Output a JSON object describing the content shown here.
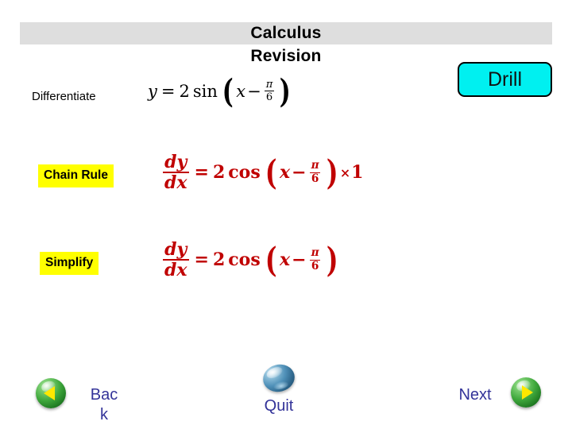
{
  "slide": {
    "title_line1": "Calculus",
    "title_line2": "Revision",
    "banner_color": "#dedede"
  },
  "drill_button": {
    "label": "Drill",
    "fill_color": "#00f0f0",
    "border_color": "#000000"
  },
  "steps": [
    {
      "label": "Differentiate",
      "highlighted": false,
      "equation_text": "y = 2 sin ( x - π/6 )",
      "color": "#000000",
      "parts": {
        "lhs": "y",
        "eq": "=",
        "coef": "2",
        "func": "sin",
        "arg_var": "x",
        "minus": "−",
        "frac_num": "π",
        "frac_den": "6"
      }
    },
    {
      "label": "Chain Rule",
      "highlighted": true,
      "highlight_color": "#ffff00",
      "equation_text": "dy/dx = 2 cos ( x - π/6 ) × 1",
      "color": "#c00000",
      "parts": {
        "lhs_num": "dy",
        "lhs_den": "dx",
        "eq": "=",
        "coef": "2",
        "func": "cos",
        "arg_var": "x",
        "minus": "−",
        "frac_num": "π",
        "frac_den": "6",
        "times": "×",
        "tail": "1"
      }
    },
    {
      "label": "Simplify",
      "highlighted": true,
      "highlight_color": "#ffff00",
      "equation_text": "dy/dx = 2 cos ( x - π/6 )",
      "color": "#c00000",
      "parts": {
        "lhs_num": "dy",
        "lhs_den": "dx",
        "eq": "=",
        "coef": "2",
        "func": "cos",
        "arg_var": "x",
        "minus": "−",
        "frac_num": "π",
        "frac_den": "6"
      }
    }
  ],
  "navigation": {
    "back": {
      "label": "Bac\nk",
      "icon": "left-arrow-orb-icon",
      "text_color": "#333399"
    },
    "quit": {
      "label": "Quit",
      "icon": "blue-orb-icon",
      "text_color": "#333399"
    },
    "next": {
      "label": "Next",
      "icon": "right-arrow-orb-icon",
      "text_color": "#333399"
    }
  }
}
